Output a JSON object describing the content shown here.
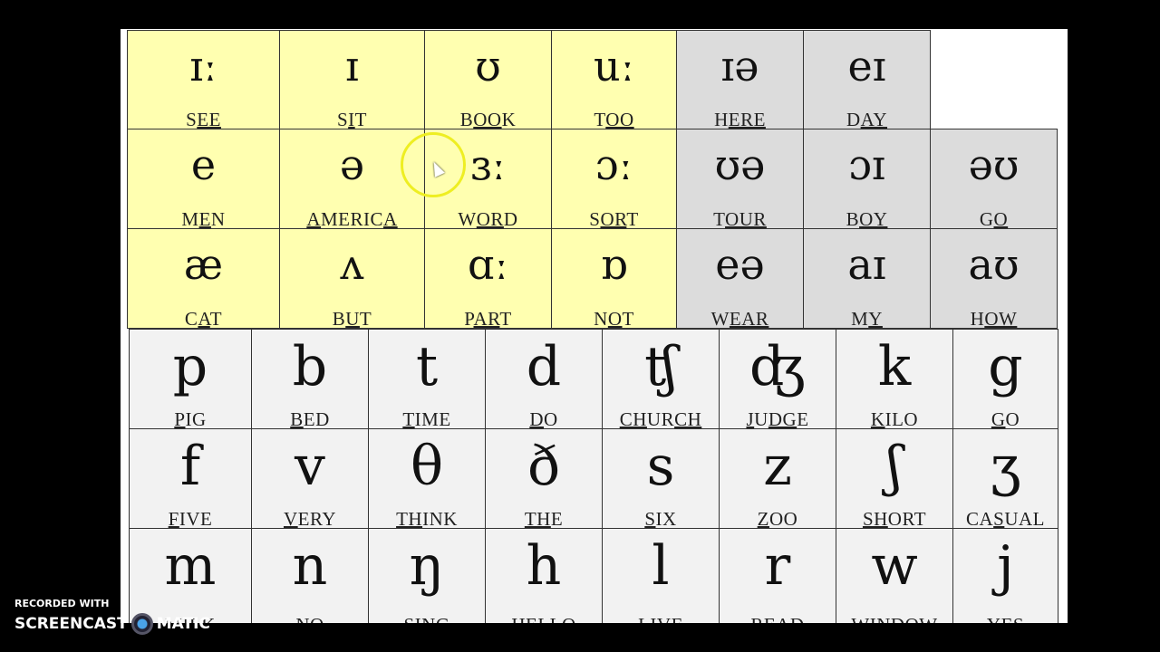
{
  "colors": {
    "monophthong_bg": "#ffffb0",
    "diphthong_bg": "#dcdcdc",
    "consonant_bg": "#f2f2f2"
  },
  "monophthongs": [
    {
      "symbol": "ɪː",
      "word": [
        "S",
        "EE",
        ""
      ]
    },
    {
      "symbol": "ɪ",
      "word": [
        "S",
        "I",
        "T"
      ]
    },
    {
      "symbol": "ʊ",
      "word": [
        "B",
        "OO",
        "K"
      ]
    },
    {
      "symbol": "uː",
      "word": [
        "T",
        "OO",
        ""
      ]
    },
    {
      "symbol": "e",
      "word": [
        "M",
        "E",
        "N"
      ]
    },
    {
      "symbol": "ə",
      "word": [
        "",
        "A",
        "MERIC",
        "A",
        ""
      ]
    },
    {
      "symbol": "ɜː",
      "word": [
        "W",
        "OR",
        "D"
      ]
    },
    {
      "symbol": "ɔː",
      "word": [
        "S",
        "OR",
        "T"
      ]
    },
    {
      "symbol": "æ",
      "word": [
        "C",
        "A",
        "T"
      ]
    },
    {
      "symbol": "ʌ",
      "word": [
        "B",
        "U",
        "T"
      ]
    },
    {
      "symbol": "ɑː",
      "word": [
        "P",
        "AR",
        "T"
      ]
    },
    {
      "symbol": "ɒ",
      "word": [
        "N",
        "O",
        "T"
      ]
    }
  ],
  "diphthongs": [
    [
      {
        "symbol": "ɪə",
        "word": [
          "H",
          "ERE",
          ""
        ]
      },
      {
        "symbol": "eɪ",
        "word": [
          "D",
          "AY",
          ""
        ]
      }
    ],
    [
      {
        "symbol": "ʊə",
        "word": [
          "T",
          "OUR",
          ""
        ]
      },
      {
        "symbol": "ɔɪ",
        "word": [
          "B",
          "OY",
          ""
        ]
      },
      {
        "symbol": "əʊ",
        "word": [
          "G",
          "O",
          ""
        ]
      }
    ],
    [
      {
        "symbol": "eə",
        "word": [
          "W",
          "EAR",
          ""
        ]
      },
      {
        "symbol": "aɪ",
        "word": [
          "M",
          "Y",
          ""
        ]
      },
      {
        "symbol": "aʊ",
        "word": [
          "H",
          "OW",
          ""
        ]
      }
    ]
  ],
  "consonants": [
    [
      {
        "symbol": "p",
        "word": [
          "",
          "P",
          "IG"
        ]
      },
      {
        "symbol": "b",
        "word": [
          "",
          "B",
          "ED"
        ]
      },
      {
        "symbol": "t",
        "word": [
          "",
          "T",
          "IME"
        ]
      },
      {
        "symbol": "d",
        "word": [
          "",
          "D",
          "O"
        ]
      },
      {
        "symbol": "ʧ",
        "word": [
          "",
          "CH",
          "UR",
          "CH",
          ""
        ]
      },
      {
        "symbol": "ʤ",
        "word": [
          "",
          "J",
          "U",
          "DG",
          "E"
        ]
      },
      {
        "symbol": "k",
        "word": [
          "",
          "K",
          "ILO"
        ]
      },
      {
        "symbol": "g",
        "word": [
          "",
          "G",
          "O"
        ]
      }
    ],
    [
      {
        "symbol": "f",
        "word": [
          "",
          "F",
          "IVE"
        ]
      },
      {
        "symbol": "v",
        "word": [
          "",
          "V",
          "ERY"
        ]
      },
      {
        "symbol": "θ",
        "word": [
          "",
          "TH",
          "INK"
        ]
      },
      {
        "symbol": "ð",
        "word": [
          "",
          "TH",
          "E"
        ]
      },
      {
        "symbol": "s",
        "word": [
          "",
          "S",
          "IX"
        ]
      },
      {
        "symbol": "z",
        "word": [
          "",
          "Z",
          "OO"
        ]
      },
      {
        "symbol": "ʃ",
        "word": [
          "",
          "SH",
          "ORT"
        ]
      },
      {
        "symbol": "ʒ",
        "word": [
          "CA",
          "S",
          "UAL"
        ]
      }
    ],
    [
      {
        "symbol": "m",
        "word": [
          "",
          "M",
          "ILK"
        ]
      },
      {
        "symbol": "n",
        "word": [
          "",
          "N",
          "O"
        ]
      },
      {
        "symbol": "ŋ",
        "word": [
          "SI",
          "NG",
          ""
        ]
      },
      {
        "symbol": "h",
        "word": [
          "",
          "H",
          "ELLO"
        ]
      },
      {
        "symbol": "l",
        "word": [
          "",
          "L",
          "IVE"
        ]
      },
      {
        "symbol": "r",
        "word": [
          "",
          "R",
          "EAD"
        ]
      },
      {
        "symbol": "w",
        "word": [
          "",
          "W",
          "INDOW"
        ]
      },
      {
        "symbol": "j",
        "word": [
          "",
          "Y",
          "ES"
        ]
      }
    ]
  ],
  "watermark": {
    "line1": "RECORDED WITH",
    "brand_left": "SCREENCAST",
    "brand_right": "MATIC"
  }
}
